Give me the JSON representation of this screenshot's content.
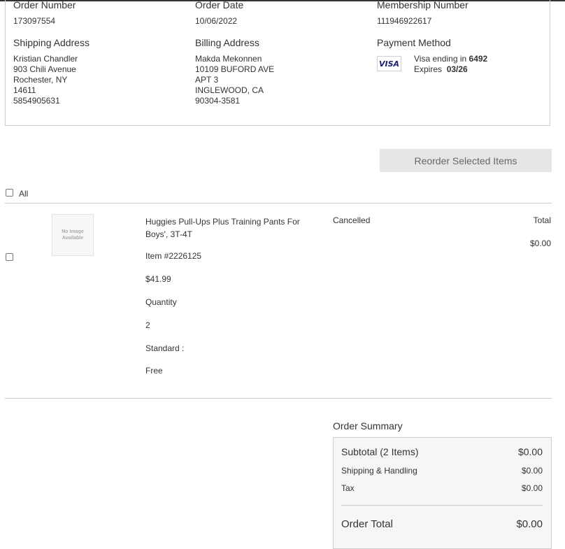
{
  "order": {
    "number_label": "Order Number",
    "number_value": "173097554",
    "date_label": "Order Date",
    "date_value": "10/06/2022",
    "membership_label": "Membership Number",
    "membership_value": "111946922617"
  },
  "shipping": {
    "label": "Shipping Address",
    "lines": [
      "Kristian Chandler",
      "903 Chili Avenue",
      "Rochester, NY",
      "14611",
      "5854905631"
    ]
  },
  "billing": {
    "label": "Billing Address",
    "lines": [
      "Makda Mekonnen",
      "10109 BUFORD AVE",
      "APT 3",
      "INGLEWOOD, CA",
      "90304-3581"
    ]
  },
  "payment": {
    "label": "Payment Method",
    "card_brand": "VISA",
    "ending_prefix": "Visa ending in",
    "ending_digits": "6492",
    "expires_prefix": "Expires",
    "expires_value": "03/26"
  },
  "actions": {
    "reorder_label": "Reorder Selected Items",
    "select_all_label": "All"
  },
  "item": {
    "image_text_1": "No Image",
    "image_text_2": "Available",
    "title_line1": "Huggies Pull-Ups Plus Training Pants For",
    "title_line2": "Boys', 3T-4T",
    "number": "Item #2226125",
    "price": "$41.99",
    "quantity_label": "Quantity",
    "quantity_value": "2",
    "shipping_label": "Standard :",
    "shipping_value": "Free",
    "status": "Cancelled",
    "total_label": "Total",
    "total_value": "$0.00"
  },
  "summary": {
    "title": "Order Summary",
    "subtotal_label": "Subtotal (2 Items)",
    "subtotal_value": "$0.00",
    "shipping_label": "Shipping & Handling",
    "shipping_value": "$0.00",
    "tax_label": "Tax",
    "tax_value": "$0.00",
    "total_label": "Order Total",
    "total_value": "$0.00"
  },
  "colors": {
    "accent_gray": "#e6e6e6",
    "border": "#cfcfcf",
    "visa_blue": "#1a1f71"
  }
}
